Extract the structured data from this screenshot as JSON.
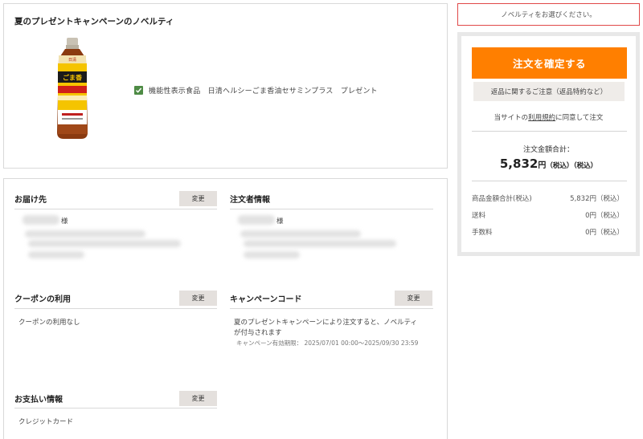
{
  "novelty": {
    "title": "夏のプレゼントキャンペーンのノベルティ",
    "option_label": "機能性表示食品　日清ヘルシーごま香油セサミンプラス　プレゼント",
    "checked": true
  },
  "shipping": {
    "title": "お届け先",
    "change_label": "変更",
    "honorific": "様"
  },
  "orderer": {
    "title": "注文者情報",
    "honorific": "様"
  },
  "coupon": {
    "title": "クーポンの利用",
    "change_label": "変更",
    "value": "クーポンの利用なし"
  },
  "campaign": {
    "title": "キャンペーンコード",
    "change_label": "変更",
    "line1": "夏のプレゼントキャンペーンにより注文すると、ノベルティ",
    "line2": "が付与されます",
    "period": "キャンペーン有効期限： 2025/07/01 00:00～2025/09/30 23:59"
  },
  "payment": {
    "title": "お支払い情報",
    "change_label": "変更",
    "value": "クレジットカード"
  },
  "sidebar": {
    "alert": "ノベルティをお選びください。",
    "confirm_label": "注文を確定する",
    "returns_label": "返品に関するご注意（返品特約など）",
    "terms_prefix": "当サイトの",
    "terms_link": "利用規約",
    "terms_suffix": "に同意して注文",
    "total_label": "注文金額合計：",
    "total_amount": "5,832",
    "total_yen": "円",
    "total_tax1": "（税込）",
    "total_tax2": "（税込）",
    "breakdown": [
      {
        "label": "商品金額合計(税込)",
        "value": "5,832円（税込）"
      },
      {
        "label": "送料",
        "value": "0円（税込）"
      },
      {
        "label": "手数料",
        "value": "0円（税込）"
      }
    ]
  },
  "colors": {
    "accent": "#ff7f00",
    "check": "#4e8b45",
    "alert_border": "#e04848"
  }
}
